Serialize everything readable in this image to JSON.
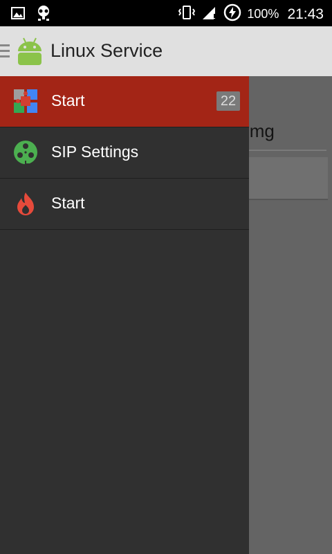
{
  "status_bar": {
    "battery_text": "100%",
    "time": "21:43"
  },
  "action_bar": {
    "title": "Linux Service"
  },
  "drawer": {
    "items": [
      {
        "label": "Start",
        "badge": "22",
        "icon": "puzzle-icon",
        "active": true
      },
      {
        "label": "SIP Settings",
        "icon": "film-reel-icon",
        "active": false
      },
      {
        "label": "Start",
        "icon": "flame-icon",
        "active": false
      }
    ]
  },
  "content": {
    "field_text": "img"
  },
  "colors": {
    "status_bar": "#000000",
    "action_bar": "#e0e0e0",
    "drawer_bg": "#303030",
    "active_item": "#a32516",
    "badge_bg": "#7a7a7a",
    "android_green": "#8bc34a",
    "sip_green": "#4caf50",
    "flame_red": "#e64a3b"
  }
}
